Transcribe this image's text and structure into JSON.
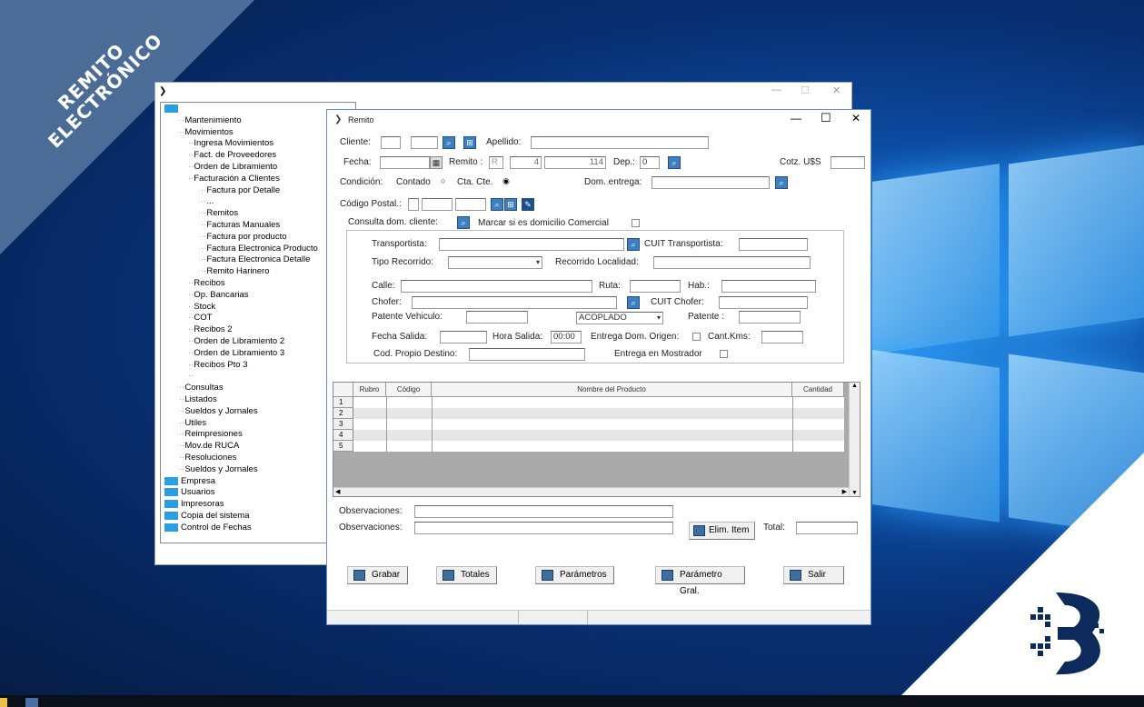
{
  "banner": {
    "line1": "REMITO",
    "line2": "ELECTRÓNICO"
  },
  "back_window": {
    "tree": [
      {
        "label": "",
        "level": 0,
        "folder": true
      },
      {
        "label": "Mantenimiento",
        "level": 1
      },
      {
        "label": "Movimientos",
        "level": 1
      },
      {
        "label": "Ingresa Movimientos",
        "level": 2
      },
      {
        "label": "Fact. de Proveedores",
        "level": 2
      },
      {
        "label": "Orden de Libramiento",
        "level": 2
      },
      {
        "label": "Facturación a Clientes",
        "level": 2
      },
      {
        "label": "Factura por Detalle",
        "level": 3
      },
      {
        "label": "...",
        "level": 3
      },
      {
        "label": "Remitos",
        "level": 3
      },
      {
        "label": "Facturas Manuales",
        "level": 3
      },
      {
        "label": "Factura por producto",
        "level": 3
      },
      {
        "label": "Factura Electronica Producto",
        "level": 3
      },
      {
        "label": "Factura Electronica Detalle",
        "level": 3
      },
      {
        "label": "Remito Harinero",
        "level": 3
      },
      {
        "label": "Recibos",
        "level": 2
      },
      {
        "label": "Op. Bancarias",
        "level": 2
      },
      {
        "label": "Stock",
        "level": 2
      },
      {
        "label": "COT",
        "level": 2
      },
      {
        "label": "Recibos 2",
        "level": 2
      },
      {
        "label": "Orden de Libramiento 2",
        "level": 2
      },
      {
        "label": "Orden de Libramiento 3",
        "level": 2
      },
      {
        "label": "Recibos Pto 3",
        "level": 2
      },
      {
        "label": "",
        "level": 2
      },
      {
        "label": "Consultas",
        "level": 1
      },
      {
        "label": "Listados",
        "level": 1
      },
      {
        "label": "Sueldos y Jornales",
        "level": 1
      },
      {
        "label": "Utiles",
        "level": 1
      },
      {
        "label": "Reimpresiones",
        "level": 1
      },
      {
        "label": "Mov.de RUCA",
        "level": 1
      },
      {
        "label": "Resoluciones",
        "level": 1
      },
      {
        "label": "Sueldos y Jornales",
        "level": 1
      },
      {
        "label": "Empresa",
        "level": 0,
        "folder": true
      },
      {
        "label": "Usuarios",
        "level": 0,
        "folder": true
      },
      {
        "label": "Impresoras",
        "level": 0,
        "folder": true
      },
      {
        "label": "Copia del sistema",
        "level": 0,
        "folder": true
      },
      {
        "label": "Control de Fechas",
        "level": 0,
        "folder": true
      }
    ]
  },
  "window": {
    "title": "Remito",
    "minimize": "—",
    "maximize": "☐",
    "close": "✕"
  },
  "form": {
    "cliente": "Cliente:",
    "apellido": "Apellido:",
    "fecha": "Fecha:",
    "remito": "Remito :",
    "remito_letter": "R",
    "remito_pto": "4",
    "remito_num": "114",
    "dep": "Dep.:",
    "dep_value": "0",
    "cotz": "Cotz. U$S",
    "condicion": "Condición:",
    "contado": "Contado",
    "cta_cte": "Cta. Cte.",
    "dom_entrega": "Dom. entrega:",
    "codigo_postal": "Código Postal.:",
    "consulta_dom": "Consulta dom. cliente:",
    "marcar_comercial": "Marcar si es domicilio Comercial",
    "transportista": "Transportista:",
    "cuit_transportista": "CUIT Transportista:",
    "tipo_recorrido": "Tipo Recorrido:",
    "recorrido_localidad": "Recorrido Localidad:",
    "calle": "Calle:",
    "ruta": "Ruta:",
    "hab": "Hab.:",
    "chofer": "Chofer:",
    "cuit_chofer": "CUIT Chofer:",
    "patente_vehiculo": "Patente Vehiculo:",
    "acoplado": "ACOPLADO",
    "patente": "Patente :",
    "fecha_salida": "Fecha Salida:",
    "hora_salida": "Hora Salida:",
    "hora_value": "00:00",
    "entrega_dom_origen": "Entrega Dom. Origen:",
    "cant_kms": "Cant.Kms:",
    "cod_propio_destino": "Cod. Propio Destino:",
    "entrega_mostrador": "Entrega en Mostrador",
    "observaciones1": "Observaciones:",
    "observaciones2": "Observaciones:",
    "elim_item": "Elim. Item",
    "total": "Total:"
  },
  "grid": {
    "columns": [
      "Rubro",
      "Código",
      "Nombre del Producto",
      "Cantidad"
    ],
    "rows": [
      "1",
      "2",
      "3",
      "4",
      "5"
    ]
  },
  "buttons": {
    "grabar": "Grabar",
    "totales": "Totales",
    "parametros": "Parámetros",
    "parametro_gral": "Parámetro Gral.",
    "salir": "Salir"
  }
}
